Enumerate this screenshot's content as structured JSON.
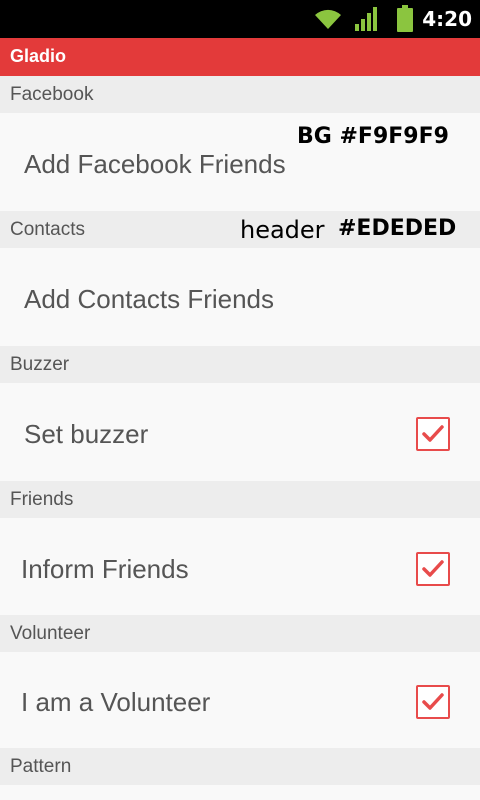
{
  "status_bar": {
    "time": "4:20",
    "icons": [
      "wifi-icon",
      "signal-icon",
      "battery-icon"
    ]
  },
  "app_bar": {
    "title": "Gladio",
    "color": "#E33A3A"
  },
  "sections": [
    {
      "header": "Facebook",
      "item": "Add Facebook Friends",
      "checkbox": false
    },
    {
      "header": "Contacts",
      "item": "Add Contacts Friends",
      "checkbox": false
    },
    {
      "header": "Buzzer",
      "item": "Set buzzer",
      "checkbox": true,
      "checked": true
    },
    {
      "header": "Friends",
      "item": "Inform Friends",
      "checkbox": true,
      "checked": true
    },
    {
      "header": "Volunteer",
      "item": "I am a Volunteer",
      "checkbox": true,
      "checked": true
    },
    {
      "header": "Pattern",
      "item": "",
      "checkbox": false
    }
  ],
  "annotations": {
    "bg_label": "BG #F9F9F9",
    "header_word": "header",
    "header_color": "#EDEDED"
  },
  "colors": {
    "background": "#F9F9F9",
    "header_background": "#EDEDED",
    "accent": "#E33A3A",
    "checkbox": "#E84B4B"
  }
}
